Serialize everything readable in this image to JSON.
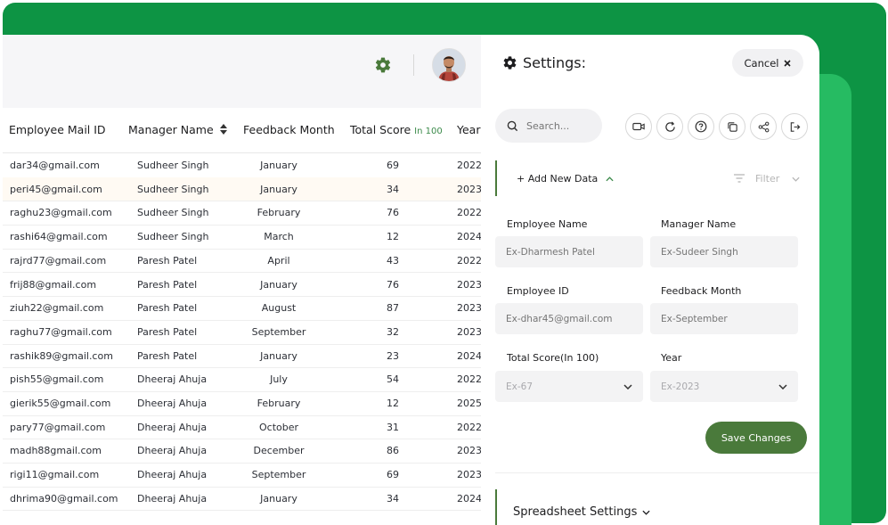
{
  "colors": {
    "accent": "#4a7a3b",
    "brand_green": "#0d9444",
    "brand_green_light": "#26bb62"
  },
  "table": {
    "headers": {
      "mail": "Employee Mail ID",
      "manager": "Manager Name",
      "month": "Feedback Month",
      "score": "Total Score",
      "score_hint": "In 100",
      "year": "Year"
    },
    "rows": [
      {
        "mail": "dar34@gmail.com",
        "manager": "Sudheer Singh",
        "month": "January",
        "score": "69",
        "year": "2022"
      },
      {
        "mail": "peri45@gmail.com",
        "manager": "Sudheer Singh",
        "month": "January",
        "score": "34",
        "year": "2023"
      },
      {
        "mail": "raghu23@gmail.com",
        "manager": "Sudheer Singh",
        "month": "February",
        "score": "76",
        "year": "2022"
      },
      {
        "mail": "rashi64@gmail.com",
        "manager": "Sudheer Singh",
        "month": "March",
        "score": "12",
        "year": "2024"
      },
      {
        "mail": "rajrd77@gmail.com",
        "manager": "Paresh Patel",
        "month": "April",
        "score": "43",
        "year": "2022"
      },
      {
        "mail": "frij88@gmail.com",
        "manager": "Paresh Patel",
        "month": "January",
        "score": "76",
        "year": "2023"
      },
      {
        "mail": "ziuh22@gmail.com",
        "manager": "Paresh Patel",
        "month": "August",
        "score": "87",
        "year": "2023"
      },
      {
        "mail": "raghu77@gmail.com",
        "manager": "Paresh Patel",
        "month": "September",
        "score": "32",
        "year": "2023"
      },
      {
        "mail": "rashik89@gmail.com",
        "manager": "Paresh Patel",
        "month": "January",
        "score": "23",
        "year": "2024"
      },
      {
        "mail": "pish55@gmail.com",
        "manager": "Dheeraj Ahuja",
        "month": "July",
        "score": "54",
        "year": "2022"
      },
      {
        "mail": "gierik55@gmail.com",
        "manager": "Dheeraj Ahuja",
        "month": "February",
        "score": "12",
        "year": "2025"
      },
      {
        "mail": "pary77@gmail.com",
        "manager": "Dheeraj Ahuja",
        "month": "October",
        "score": "31",
        "year": "2022"
      },
      {
        "mail": "madh88gmail.com",
        "manager": "Dheeraj Ahuja",
        "month": "December",
        "score": "86",
        "year": "2023"
      },
      {
        "mail": "rigi11@gmail.com",
        "manager": "Dheeraj Ahuja",
        "month": "September",
        "score": "69",
        "year": "2023"
      },
      {
        "mail": "dhrima90@gmail.com",
        "manager": "Dheeraj Ahuja",
        "month": "January",
        "score": "34",
        "year": "2024"
      }
    ]
  },
  "settings": {
    "title": "Settings:",
    "cancel_label": "Cancel",
    "search_placeholder": "Search...",
    "add_new_label": "+ Add New Data",
    "filter_label": "Filter",
    "fields": {
      "employee_name": {
        "label": "Employee Name",
        "placeholder": "Ex-Dharmesh Patel"
      },
      "manager_name": {
        "label": "Manager Name",
        "placeholder": "Ex-Sudeer Singh"
      },
      "employee_id": {
        "label": "Employee ID",
        "placeholder": "Ex-dhar45@gmail.com"
      },
      "feedback_month": {
        "label": "Feedback Month",
        "placeholder": "Ex-September"
      },
      "total_score": {
        "label": "Total Score(In 100)",
        "placeholder": "Ex-67"
      },
      "year": {
        "label": "Year",
        "placeholder": "Ex-2023"
      }
    },
    "save_label": "Save Changes",
    "spreadsheet_settings_label": "Spreadsheet Settings"
  },
  "icons": [
    "gear-icon",
    "avatar",
    "sort-icon",
    "search-icon",
    "video-icon",
    "refresh-icon",
    "help-icon",
    "copy-icon",
    "share-icon",
    "logout-icon",
    "filter-icon",
    "chevron-down-icon",
    "chevron-up-icon",
    "close-icon"
  ]
}
